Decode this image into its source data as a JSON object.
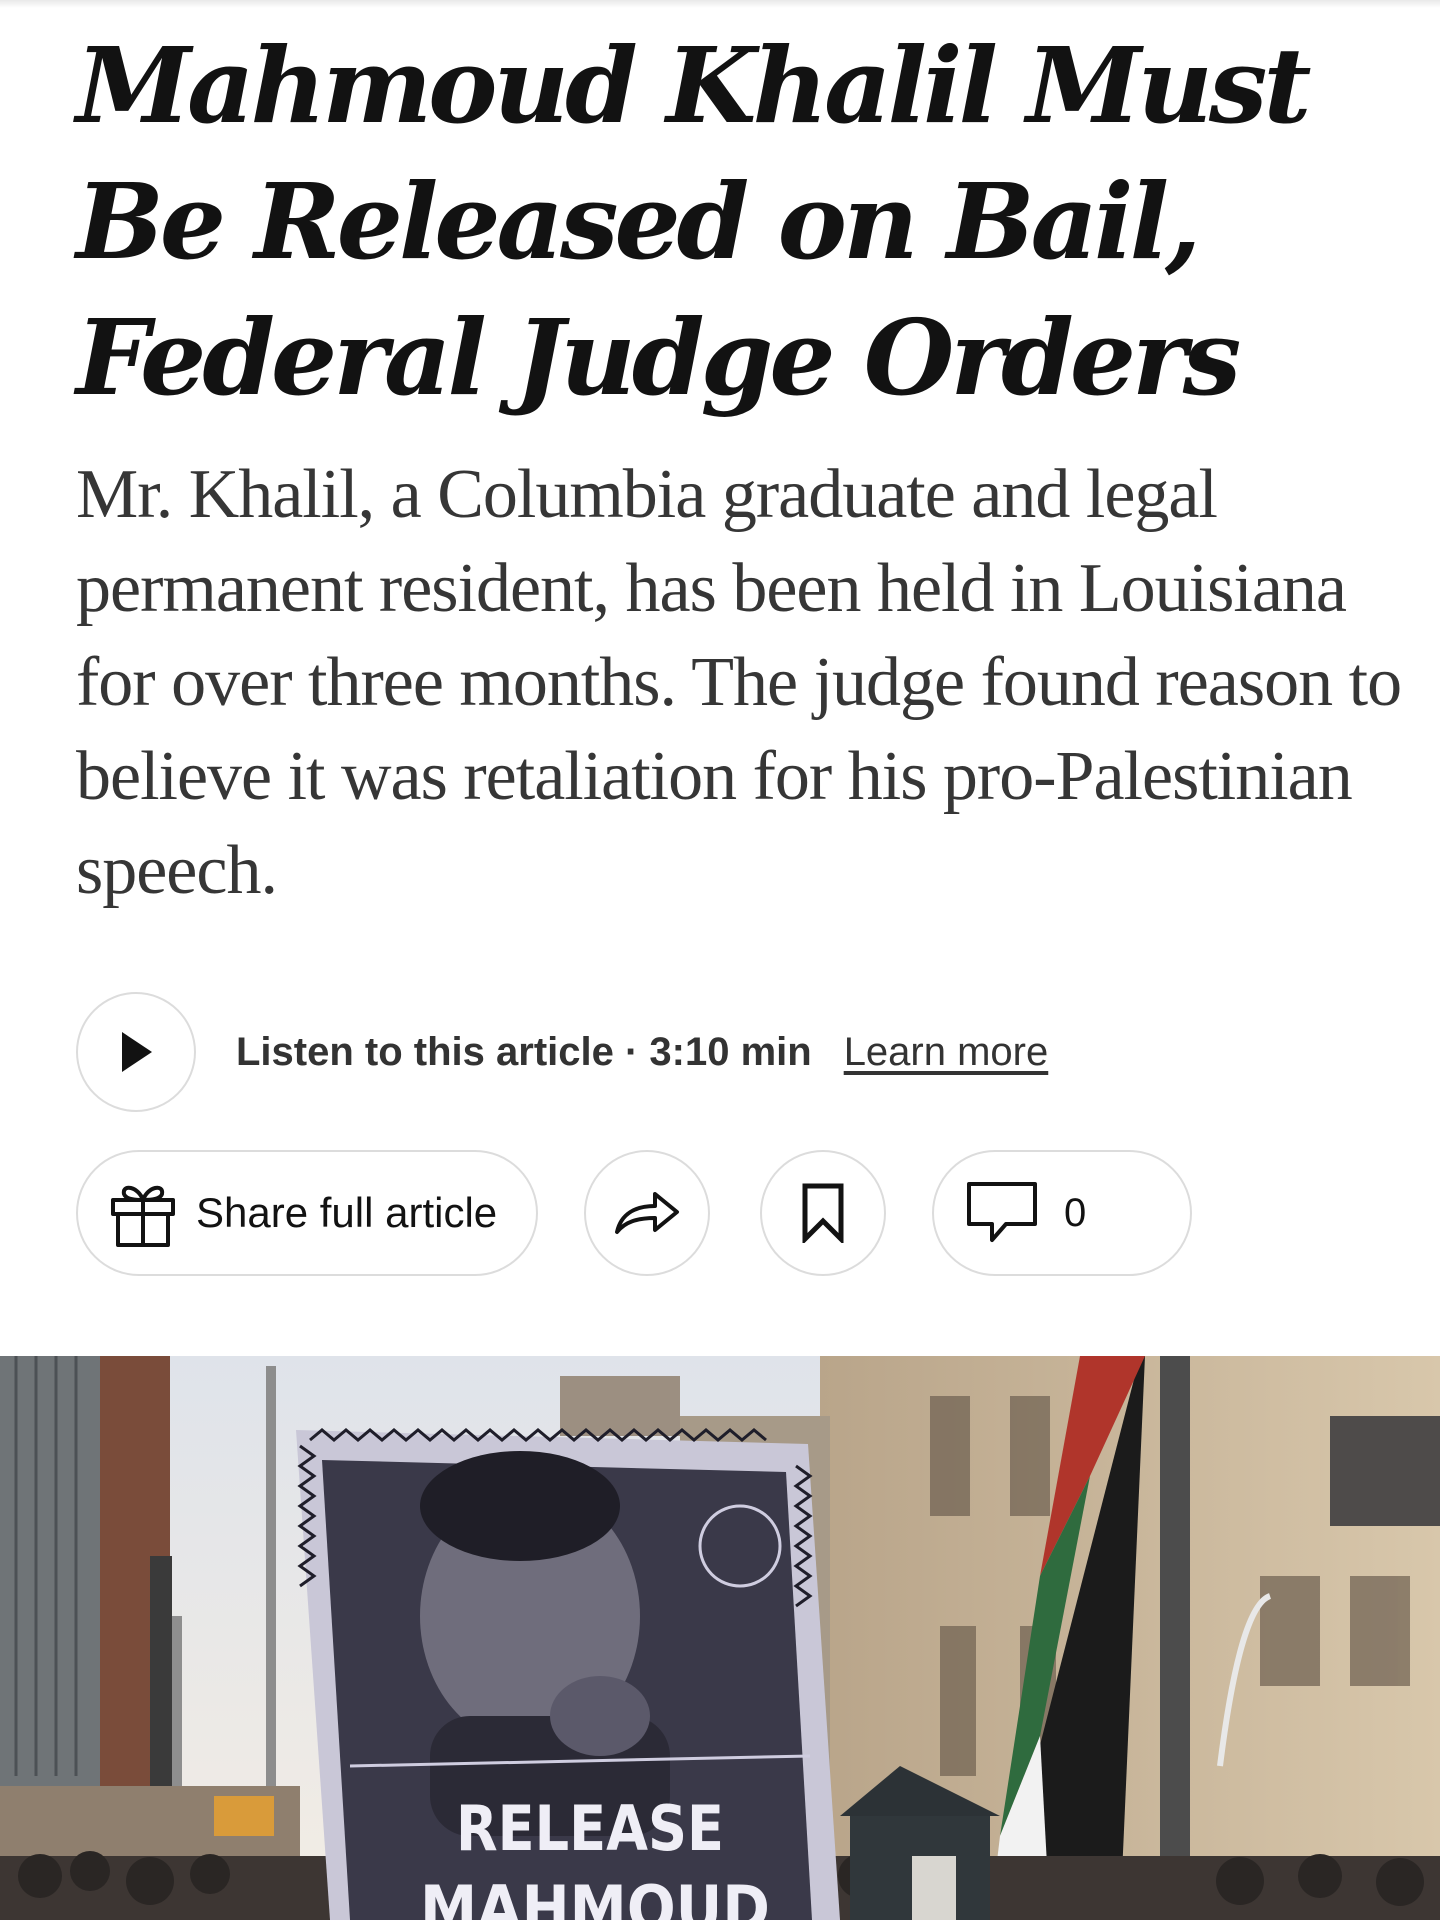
{
  "article": {
    "headline": "Mahmoud Khalil Must Be Released on Bail, Federal Judge Orders",
    "summary": "Mr. Khalil, a Columbia graduate and legal permanent resident, has been held in Louisiana for over three months. The judge found reason to believe it was retaliation for his pro-Palestinian speech."
  },
  "audio": {
    "listen_label": "Listen to this article · 3:10 min",
    "learn_more": "Learn more",
    "play_icon": "play-icon"
  },
  "actions": {
    "share_full_article": "Share full article",
    "share_icon": "share-arrow-icon",
    "gift_icon": "gift-icon",
    "bookmark_icon": "bookmark-icon",
    "comment_icon": "comment-icon",
    "comment_count": "0"
  },
  "photo": {
    "sign_line1": "RELEASE",
    "sign_line2": "MAHMOUD"
  },
  "colors": {
    "text_primary": "#121212",
    "text_secondary": "#363636",
    "border": "#dcdcdc"
  }
}
